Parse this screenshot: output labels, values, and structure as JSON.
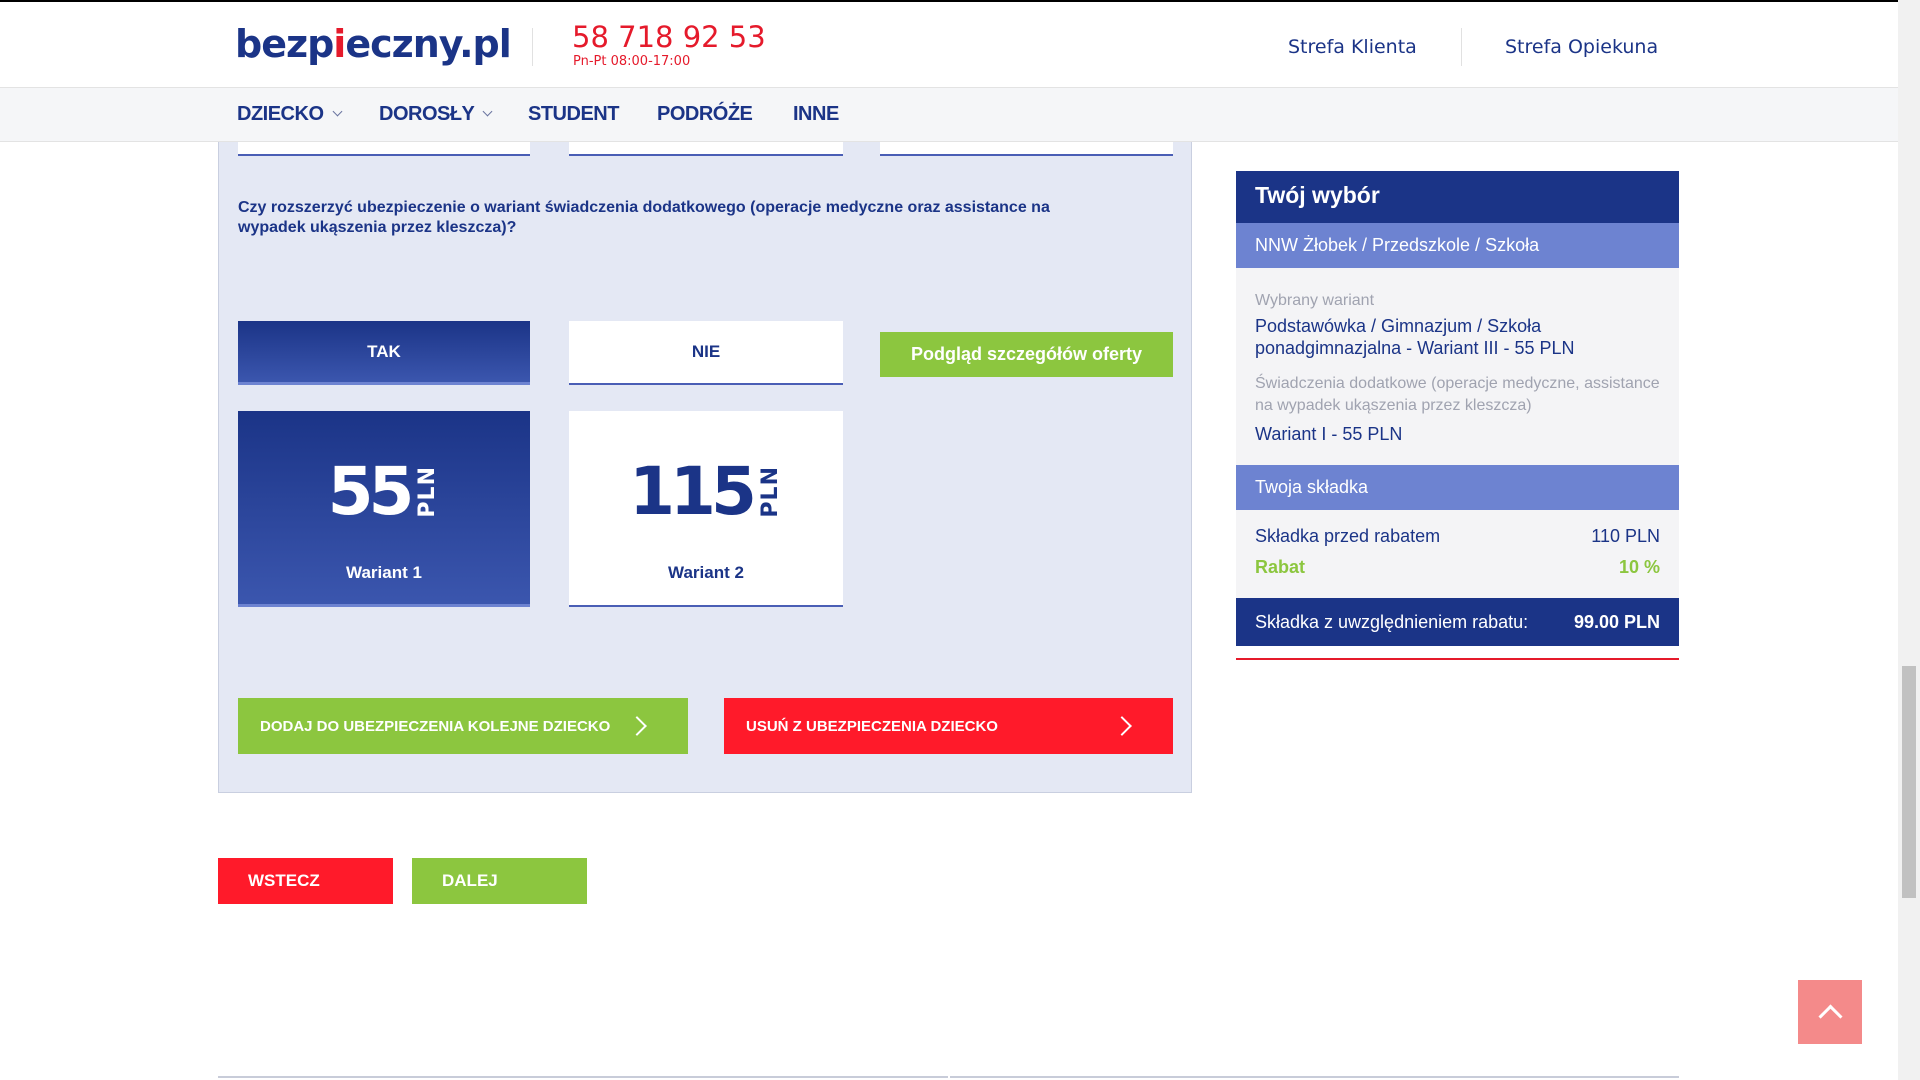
{
  "header": {
    "logo_left": "bezp",
    "logo_dot": "i",
    "logo_right": "eczny.pl",
    "phone": "58 718 92 53",
    "hours": "Pn-Pt 08:00-17:00",
    "links": [
      "Strefa Klienta",
      "Strefa Opiekuna"
    ]
  },
  "nav": {
    "items": [
      {
        "label": "DZIECKO",
        "dropdown": true
      },
      {
        "label": "DOROSŁY",
        "dropdown": true
      },
      {
        "label": "STUDENT",
        "dropdown": false
      },
      {
        "label": "PODRÓŻE",
        "dropdown": false
      },
      {
        "label": "INNE",
        "dropdown": false
      }
    ]
  },
  "form": {
    "question": "Czy rozszerzyć ubezpieczenie o wariant świadczenia dodatkowego (operacje medyczne oraz assistance na wypadek ukąszenia przez kleszcza)?",
    "yes_label": "TAK",
    "no_label": "NIE",
    "preview_label": "Podgląd szczegółów oferty",
    "variants": [
      {
        "amount": "55",
        "currency": "PLN",
        "label": "Wariant 1",
        "selected": true
      },
      {
        "amount": "115",
        "currency": "PLN",
        "label": "Wariant 2",
        "selected": false
      }
    ],
    "add_child_label": "DODAJ DO UBEZPIECZENIA KOLEJNE DZIECKO",
    "remove_child_label": "USUŃ Z UBEZPIECZENIA DZIECKO",
    "back_label": "WSTECZ",
    "next_label": "DALEJ"
  },
  "summary": {
    "title": "Twój wybór",
    "product": "NNW Żłobek / Przedszkole / Szkoła",
    "selected_variant_label": "Wybrany wariant",
    "selected_variant_value": "Podstawówka / Gimnazjum / Szkoła ponadgimnazjalna - Wariant III - 55 PLN",
    "extra_label": "Świadczenia dodatkowe (operacje medyczne, assistance na wypadek ukąszenia przez kleszcza)",
    "extra_value": "Wariant I - 55 PLN",
    "premium_header": "Twoja składka",
    "before_discount_label": "Składka przed rabatem",
    "before_discount_value": "110 PLN",
    "discount_label": "Rabat",
    "discount_value": "10 %",
    "total_label": "Składka z uwzględnieniem rabatu:",
    "total_value": "99.00 PLN"
  },
  "colors": {
    "brand_blue": "#1b3487",
    "accent_red": "#e51a2b",
    "accent_green": "#8cc63f",
    "light_blue": "#6d83d1"
  }
}
